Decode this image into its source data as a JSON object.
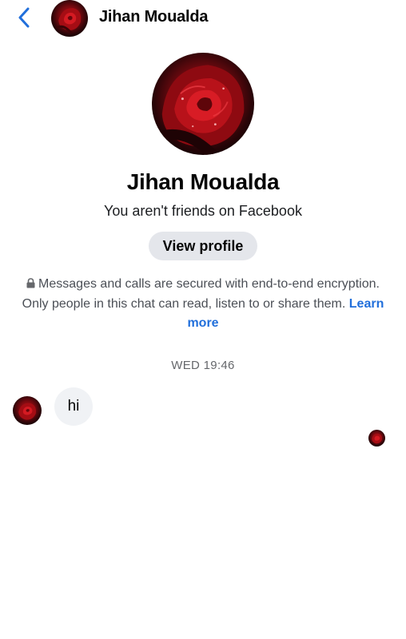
{
  "header": {
    "back_icon": "chevron-left-icon",
    "contact_name": "Jihan Moualda",
    "accent_color": "#216fdb"
  },
  "profile": {
    "name": "Jihan Moualda",
    "friend_status": "You aren't friends on Facebook",
    "view_profile_label": "View profile"
  },
  "encryption_notice": {
    "icon": "lock-icon",
    "text": "Messages and calls are secured with end-to-end encryption. Only people in this chat can read, listen to or share them.",
    "link_label": "Learn more",
    "link_color": "#216fdb"
  },
  "conversation": {
    "timestamp": "WED 19:46",
    "messages": [
      {
        "sender": "contact",
        "text": "hi"
      }
    ]
  }
}
